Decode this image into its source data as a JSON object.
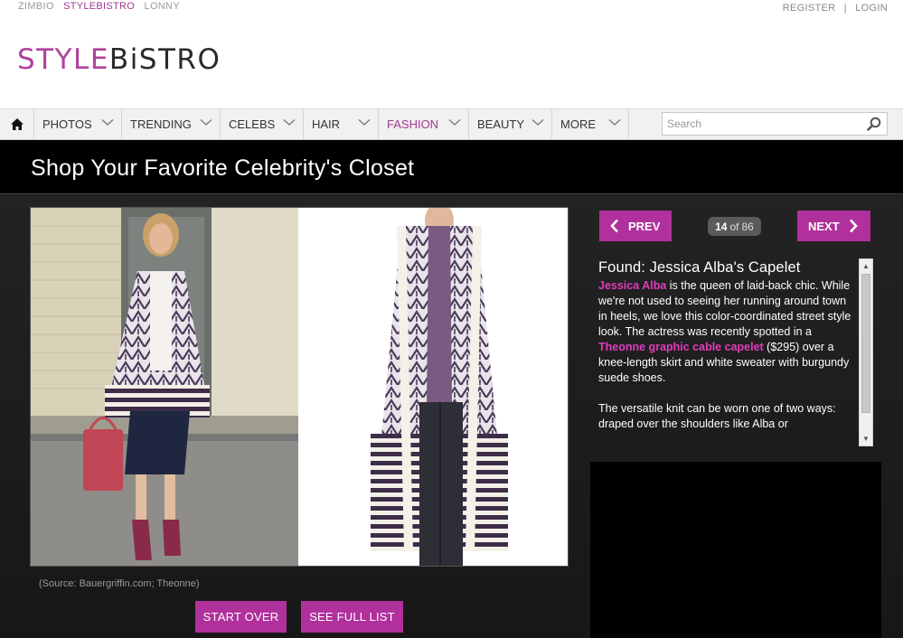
{
  "network": {
    "sites": [
      "ZIMBIO",
      "STYLEBISTRO",
      "LONNY"
    ],
    "active_site": "STYLEBISTRO"
  },
  "account": {
    "register": "REGISTER",
    "separator": "|",
    "login": "LOGIN"
  },
  "logo": {
    "part1": "STYLE",
    "part2": "BiSTRO"
  },
  "nav": {
    "home_icon": "home-icon",
    "items": [
      {
        "label": "PHOTOS"
      },
      {
        "label": "TRENDING"
      },
      {
        "label": "CELEBS"
      },
      {
        "label": "HAIR"
      },
      {
        "label": "FASHION"
      },
      {
        "label": "BEAUTY"
      },
      {
        "label": "MORE"
      }
    ],
    "active_item": "FASHION",
    "search_placeholder": "Search"
  },
  "page_title": "Shop Your Favorite Celebrity's Closet",
  "gallery": {
    "prev_label": "PREV",
    "next_label": "NEXT",
    "current": "14",
    "of": "of",
    "total": "86",
    "source": "(Source: Bauergriffin.com; Theonne)",
    "start_over": "START OVER",
    "see_full_list": "SEE FULL LIST"
  },
  "story": {
    "headline": "Found: Jessica Alba's Capelet",
    "p1": {
      "link1": "Jessica Alba",
      "text1": " is the queen of laid-back chic. While we're not used to seeing her running around town in heels, we love this color-coordinated street style look. The actress was recently spotted in a ",
      "link2": "Theonne graphic cable capelet",
      "text2": " ($295) over a knee-length skirt and white sweater with burgundy suede shoes."
    },
    "p2": "The versatile knit can be worn one of two ways: draped over the shoulders like Alba or"
  },
  "colors": {
    "brand": "#b0309c",
    "highlight": "#e13dbd",
    "dark_bg": "#1c1c1c",
    "title_bg": "#000000"
  }
}
